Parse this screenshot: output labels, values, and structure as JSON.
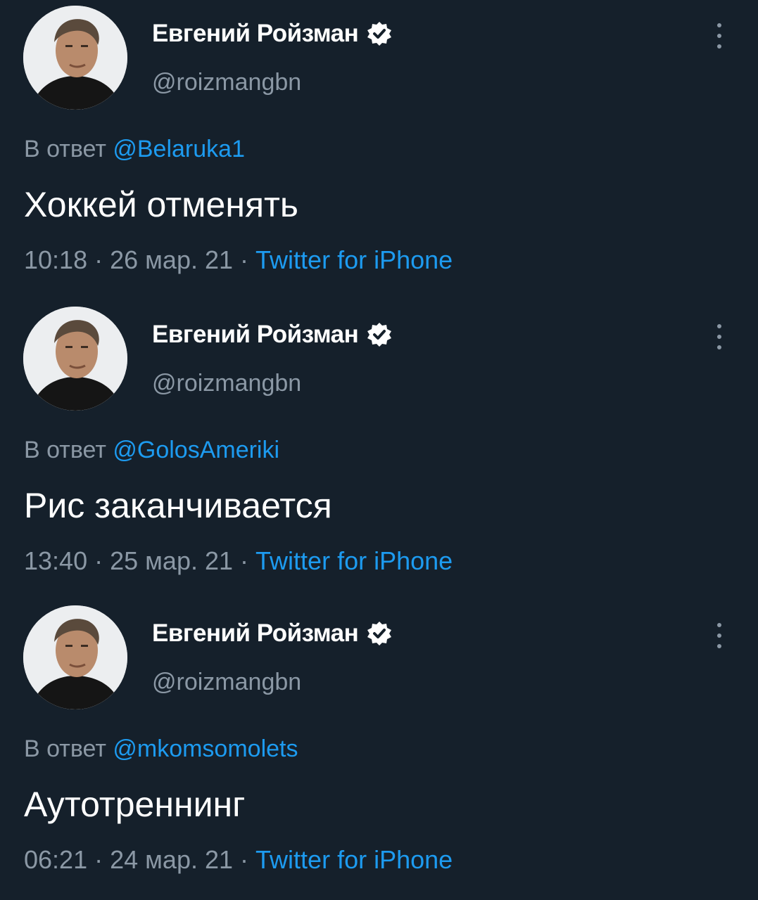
{
  "tweets": [
    {
      "author_name": "Евгений Ройзман",
      "handle": "@roizmangbn",
      "reply_prefix": "В ответ",
      "reply_to": "@Belaruka1",
      "text": "Хоккей отменять",
      "time": "10:18",
      "date": "26 мар. 21",
      "source": "Twitter for iPhone",
      "separator": "·"
    },
    {
      "author_name": "Евгений Ройзман",
      "handle": "@roizmangbn",
      "reply_prefix": "В ответ",
      "reply_to": "@GolosAmeriki",
      "text": "Рис заканчивается",
      "time": "13:40",
      "date": "25 мар. 21",
      "source": "Twitter for iPhone",
      "separator": "·"
    },
    {
      "author_name": "Евгений Ройзман",
      "handle": "@roizmangbn",
      "reply_prefix": "В ответ",
      "reply_to": "@mkomsomolets",
      "text": "Аутотреннинг",
      "time": "06:21",
      "date": "24 мар. 21",
      "source": "Twitter for iPhone",
      "separator": "·"
    }
  ],
  "icons": {
    "verified": "verified-badge-icon",
    "more": "more-vertical-icon",
    "avatar": "profile-photo"
  },
  "colors": {
    "background": "#15202b",
    "primary_text": "#ffffff",
    "secondary_text": "#8b98a5",
    "link": "#1d9bf0"
  }
}
